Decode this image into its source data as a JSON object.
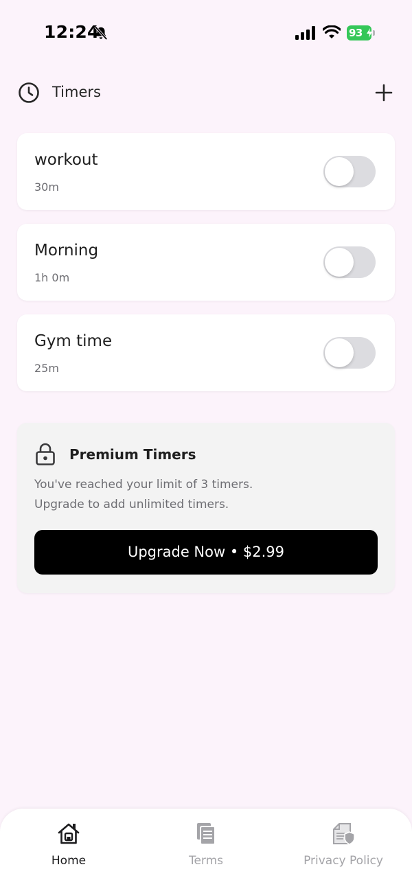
{
  "status_bar": {
    "time": "12:24",
    "battery_level": "93"
  },
  "header": {
    "title": "Timers"
  },
  "timers": [
    {
      "name": "workout",
      "duration": "30m",
      "enabled": false
    },
    {
      "name": "Morning",
      "duration": "1h 0m",
      "enabled": false
    },
    {
      "name": "Gym time",
      "duration": "25m",
      "enabled": false
    }
  ],
  "premium": {
    "title": "Premium Timers",
    "line1": "You've reached your limit of 3 timers.",
    "line2": "Upgrade to add unlimited timers.",
    "button_label": "Upgrade Now • $2.99"
  },
  "tabs": [
    {
      "label": "Home",
      "icon": "home-icon",
      "active": true
    },
    {
      "label": "Terms",
      "icon": "document-icon",
      "active": false
    },
    {
      "label": "Privacy Policy",
      "icon": "privacy-shield-icon",
      "active": false
    }
  ],
  "colors": {
    "background": "#fcf3fb",
    "battery": "#35c759",
    "toggle_off": "#dcdce0",
    "button": "#000000"
  }
}
